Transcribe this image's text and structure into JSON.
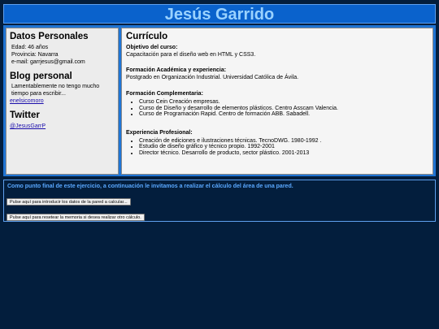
{
  "header": {
    "name": "Jesús Garrido"
  },
  "sidebar": {
    "personal_title": "Datos Personales",
    "age": "Edad: 46 años",
    "province": "Provincia: Navarra",
    "email": "e-mail: garrjesus@gmail.com",
    "blog_title": "Blog personal",
    "blog_text": "Lamentablemente no tengo mucho tiempo para escribir...",
    "blog_link": "enelsicomoro",
    "twitter_title": "Twitter",
    "twitter_link": "@JesusGarrP"
  },
  "cv": {
    "title": "Currículo",
    "objective_label": "Objetivo del curso:",
    "objective_text": "Capacitación para el diseño web en HTML y CSS3.",
    "academic_label": "Formación Académica y experiencia:",
    "academic_text": "Postgrado en Organización Industrial. Universidad Católica de Ávila.",
    "complementary_label": "Formación Complementaria:",
    "complementary_items": [
      "Curso Cein Creación empresas.",
      "Curso de Diseño y desarrollo de elementos plásticos. Centro Asscam Valencia.",
      "Curso de Programación Rapid. Centro de formación ABB. Sabadell."
    ],
    "experience_label": "Experiencia Profesional:",
    "experience_items": [
      "Creación de ediciones e ilustraciones técnicas. TecnoDWG. 1980-1992 .",
      "Estudio de diseño gráfico y técnico propio. 1992-2001",
      "Director técnico. Desarrollo de producto, sector plástico. 2001-2013"
    ]
  },
  "exercise": {
    "intro": "Como punto final de este ejercicio, a continuación le invitamos a realizar el cálculo del área de una pared.",
    "button_input": "Pulse aquí para introducir los datos de la pared a calcular...",
    "button_reset": "Pulse aquí para resetear la memoria si desea realizar otro cálculo."
  },
  "colors": {
    "background": "#031e3d",
    "header_bg": "#0a62cc",
    "header_text": "#9ad2ff",
    "accent_text": "#5aa8ff"
  }
}
